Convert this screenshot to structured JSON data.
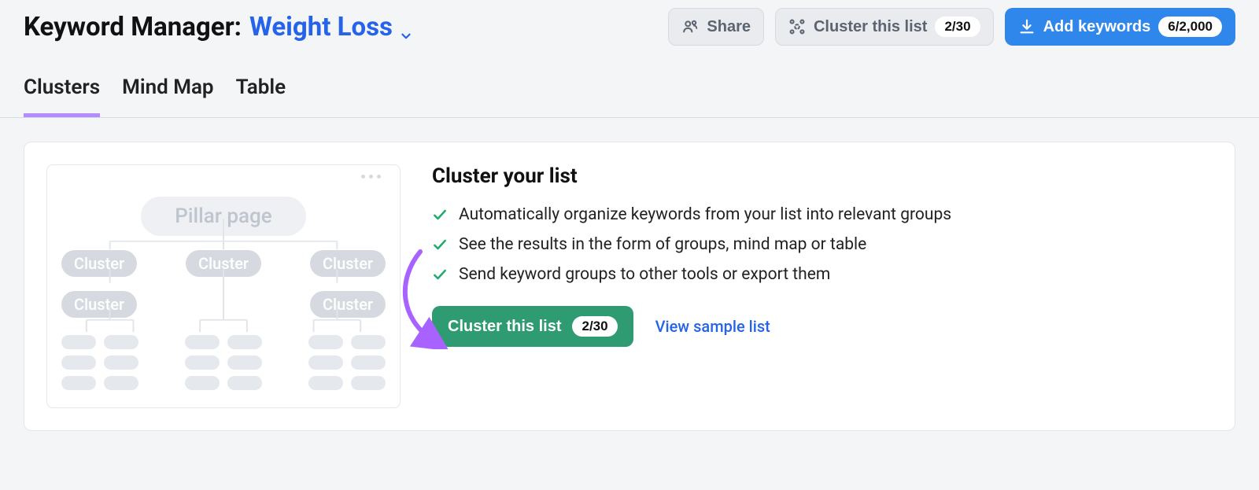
{
  "header": {
    "title_prefix": "Keyword Manager:",
    "list_name": "Weight Loss",
    "share_label": "Share",
    "cluster_label": "Cluster this list",
    "cluster_counter": "2/30",
    "add_label": "Add keywords",
    "add_counter": "6/2,000"
  },
  "tabs": {
    "items": [
      {
        "label": "Clusters",
        "active": true
      },
      {
        "label": "Mind Map",
        "active": false
      },
      {
        "label": "Table",
        "active": false
      }
    ]
  },
  "illustration": {
    "pillar_label": "Pillar page",
    "cluster_label": "Cluster"
  },
  "promo": {
    "heading": "Cluster your list",
    "bullets": [
      "Automatically organize keywords from your list into relevant groups",
      "See the results in the form of groups, mind map or table",
      "Send keyword groups to other tools or export them"
    ],
    "cta_label": "Cluster this list",
    "cta_counter": "2/30",
    "sample_link": "View sample list"
  }
}
